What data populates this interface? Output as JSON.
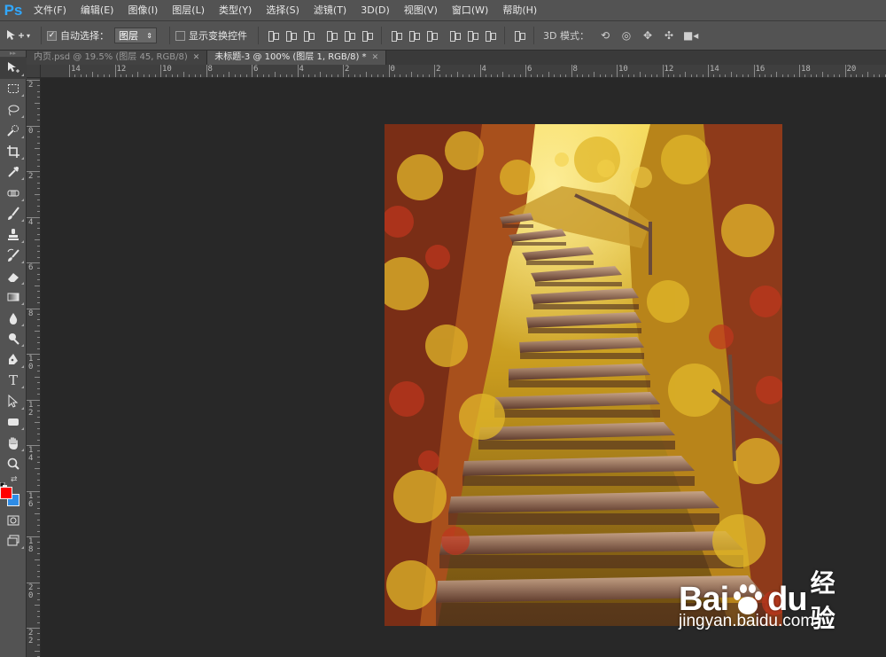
{
  "app": {
    "logo": "Ps"
  },
  "menu": [
    "文件(F)",
    "编辑(E)",
    "图像(I)",
    "图层(L)",
    "类型(Y)",
    "选择(S)",
    "滤镜(T)",
    "3D(D)",
    "视图(V)",
    "窗口(W)",
    "帮助(H)"
  ],
  "options": {
    "auto_select_label": "自动选择：",
    "auto_select_checked": true,
    "auto_select_value": "图层",
    "show_transform_label": "显示变换控件",
    "show_transform_checked": false,
    "mode_3d_label": "3D 模式："
  },
  "tabs": [
    {
      "label": "内页.psd @ 19.5% (图层 45, RGB/8)",
      "active": false
    },
    {
      "label": "未标题-3 @ 100% (图层 1, RGB/8) *",
      "active": true
    }
  ],
  "ruler_top": [
    "14",
    "12",
    "10",
    "8",
    "6",
    "4",
    "2",
    "0",
    "2",
    "4",
    "6",
    "8",
    "10",
    "12",
    "14",
    "16",
    "18",
    "20"
  ],
  "ruler_left": [
    "2",
    "0",
    "2",
    "4",
    "6",
    "8",
    "10",
    "12",
    "14",
    "16",
    "18",
    "20",
    "22"
  ],
  "colors": {
    "foreground": "#ff0000",
    "background": "#2e8ce6"
  },
  "watermark": {
    "brand_latin": "Bai",
    "brand_latin2": "du",
    "brand_cn": "经验",
    "url": "jingyan.baidu.com"
  }
}
